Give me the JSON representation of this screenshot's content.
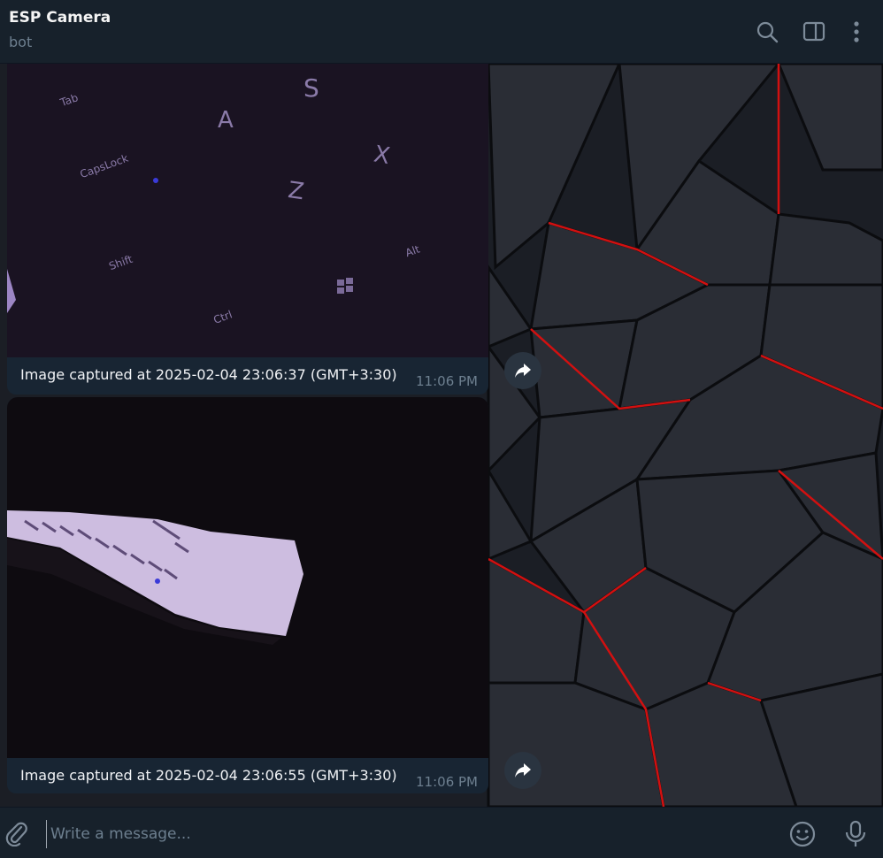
{
  "header": {
    "title": "ESP Camera",
    "subtitle": "bot"
  },
  "icons": {
    "search": "search-icon",
    "sidebar": "sidebar-toggle-icon",
    "menu": "more-vertical-icon",
    "share": "forward-icon",
    "attach": "paperclip-icon",
    "emoji": "emoji-icon",
    "mic": "microphone-icon"
  },
  "messages": [
    {
      "caption": "Image captured at 2025-02-04 23:06:37 (GMT+3:30)",
      "time": "11:06 PM"
    },
    {
      "caption": "Image captured at 2025-02-04 23:06:55 (GMT+3:30)",
      "time": "11:06 PM"
    }
  ],
  "composer": {
    "placeholder": "Write a message..."
  },
  "colors": {
    "header_bg": "#17212b",
    "bubble_bg": "#182533",
    "accent_red": "#d21010"
  }
}
